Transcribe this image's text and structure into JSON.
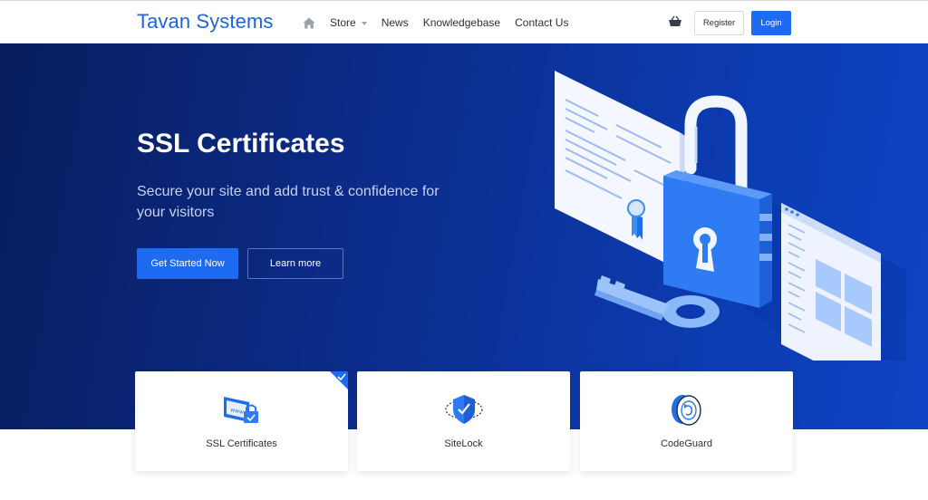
{
  "header": {
    "brand": "Tavan Systems",
    "nav": [
      {
        "id": "store",
        "label": "Store",
        "has_dropdown": true
      },
      {
        "id": "news",
        "label": "News"
      },
      {
        "id": "knowledgebase",
        "label": "Knowledgebase"
      },
      {
        "id": "contact",
        "label": "Contact Us"
      }
    ],
    "register_label": "Register",
    "login_label": "Login",
    "icons": {
      "home": "home-icon",
      "cart": "basket-icon"
    }
  },
  "hero": {
    "title": "SSL Certificates",
    "subtitle": "Secure your site and add trust & confidence for your visitors",
    "primary_cta": "Get Started Now",
    "secondary_cta": "Learn more",
    "illustration": "padlock-key-certificate-illustration"
  },
  "cards": [
    {
      "label": "SSL Certificates",
      "icon": "ssl-certificate-icon",
      "selected": true
    },
    {
      "label": "SiteLock",
      "icon": "sitelock-shield-icon",
      "selected": false
    },
    {
      "label": "CodeGuard",
      "icon": "codeguard-disc-icon",
      "selected": false
    }
  ],
  "colors": {
    "brand": "#1f63d8",
    "primary": "#1d6bf3",
    "hero_dark": "#081d5e",
    "hero_light": "#0e44c4",
    "text": "#2b2f36"
  }
}
